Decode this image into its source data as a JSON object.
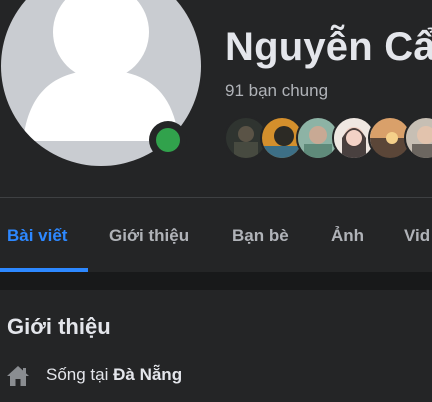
{
  "profile": {
    "name": "Nguyễn Cẩ",
    "mutual_friends": "91 bạn chung",
    "online": true
  },
  "mutual_friend_avatars": [
    {
      "name": "friend-1",
      "color": "#3a3f3a"
    },
    {
      "name": "friend-2",
      "color": "#c9872a"
    },
    {
      "name": "friend-3",
      "color": "#6f9a86"
    },
    {
      "name": "friend-4",
      "color": "#e8ddd6"
    },
    {
      "name": "friend-5",
      "color": "#a7795a"
    },
    {
      "name": "friend-6",
      "color": "#b9b2a8"
    }
  ],
  "tabs": [
    {
      "label": "Bài viết",
      "active": true
    },
    {
      "label": "Giới thiệu",
      "active": false
    },
    {
      "label": "Bạn bè",
      "active": false
    },
    {
      "label": "Ảnh",
      "active": false
    },
    {
      "label": "Vid",
      "active": false
    }
  ],
  "intro": {
    "title": "Giới thiệu",
    "lives_in_prefix": "Sống tại",
    "lives_in_place": "Đà Nẵng"
  },
  "colors": {
    "accent": "#2d88ff",
    "online": "#31a24c",
    "background": "#18191a",
    "surface": "#242526"
  },
  "icons": {
    "lives_in": "home-icon",
    "avatar": "default-avatar-icon"
  }
}
